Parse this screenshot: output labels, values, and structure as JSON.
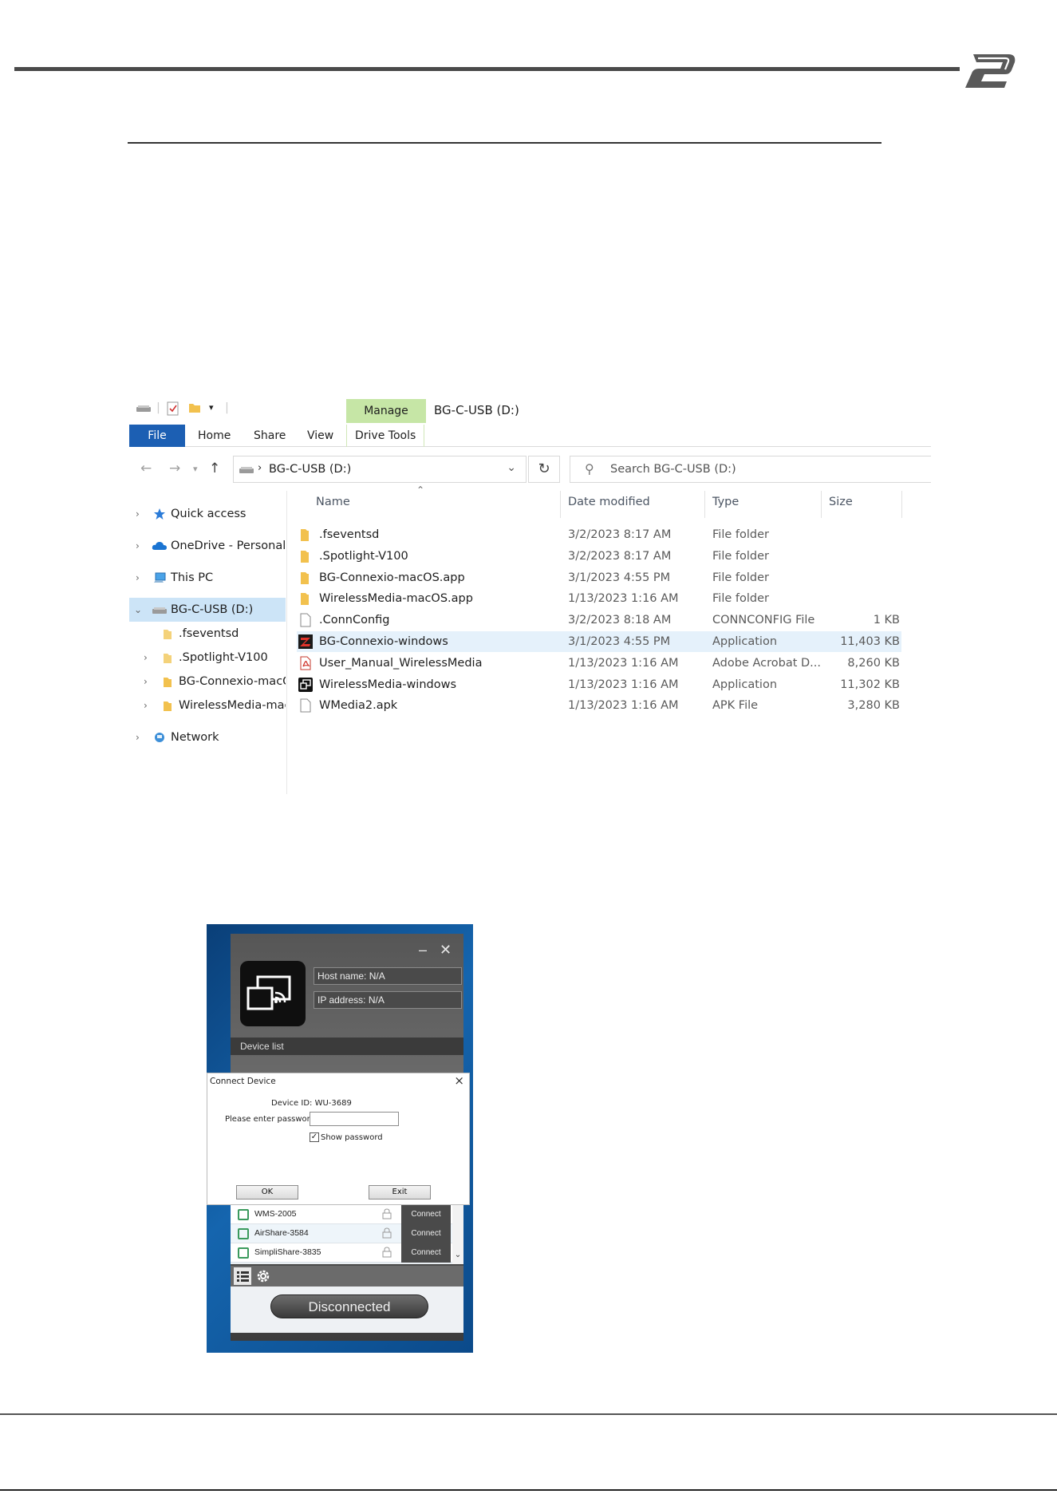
{
  "explorer": {
    "ribbon": {
      "manage": "Manage",
      "title": "BG-C-USB (D:)",
      "tabs": [
        "File",
        "Home",
        "Share",
        "View",
        "Drive Tools"
      ]
    },
    "address": {
      "path": "BG-C-USB (D:)",
      "search_placeholder": "Search BG-C-USB (D:)"
    },
    "nav": [
      {
        "label": "Quick access"
      },
      {
        "label": "OneDrive - Personal"
      },
      {
        "label": "This PC"
      },
      {
        "label": "BG-C-USB (D:)"
      },
      {
        "label": ".fseventsd"
      },
      {
        "label": ".Spotlight-V100"
      },
      {
        "label": "BG-Connexio-macO"
      },
      {
        "label": "WirelessMedia-mac"
      },
      {
        "label": "Network"
      }
    ],
    "columns": [
      "Name",
      "Date modified",
      "Type",
      "Size"
    ],
    "files": [
      {
        "name": ".fseventsd",
        "date": "3/2/2023 8:17 AM",
        "type": "File folder",
        "size": "",
        "icon": "folder-icon"
      },
      {
        "name": ".Spotlight-V100",
        "date": "3/2/2023 8:17 AM",
        "type": "File folder",
        "size": "",
        "icon": "folder-icon"
      },
      {
        "name": "BG-Connexio-macOS.app",
        "date": "3/1/2023 4:55 PM",
        "type": "File folder",
        "size": "",
        "icon": "folder-icon"
      },
      {
        "name": "WirelessMedia-macOS.app",
        "date": "1/13/2023 1:16 AM",
        "type": "File folder",
        "size": "",
        "icon": "folder-icon"
      },
      {
        "name": ".ConnConfig",
        "date": "3/2/2023 8:18 AM",
        "type": "CONNCONFIG File",
        "size": "1 KB",
        "icon": "file-icon"
      },
      {
        "name": "BG-Connexio-windows",
        "date": "3/1/2023 4:55 PM",
        "type": "Application",
        "size": "11,403 KB",
        "icon": "bg-app-icon"
      },
      {
        "name": "User_Manual_WirelessMedia",
        "date": "1/13/2023 1:16 AM",
        "type": "Adobe Acrobat D...",
        "size": "8,260 KB",
        "icon": "pdf-icon"
      },
      {
        "name": "WirelessMedia-windows",
        "date": "1/13/2023 1:16 AM",
        "type": "Application",
        "size": "11,302 KB",
        "icon": "wm-app-icon"
      },
      {
        "name": "WMedia2.apk",
        "date": "1/13/2023 1:16 AM",
        "type": "APK File",
        "size": "3,280 KB",
        "icon": "file-icon"
      }
    ]
  },
  "app": {
    "host_name": "Host name:  N/A",
    "ip_address": "IP address:  N/A",
    "device_list": "Device list",
    "dialog": {
      "title": "Connect Device",
      "device_id": "Device ID:  WU-3689",
      "password_label": "Please enter password:",
      "show_password": "Show password",
      "ok": "OK",
      "exit": "Exit"
    },
    "devices": [
      {
        "name": "WMS-2005",
        "action": "Connect"
      },
      {
        "name": "AirShare-3584",
        "action": "Connect"
      },
      {
        "name": "SimpliShare-3835",
        "action": "Connect"
      }
    ],
    "status": "Disconnected"
  },
  "colors": {
    "accent": "#1c5fb3",
    "manage_tab": "#c6e6a6",
    "selection": "#cce4f7"
  }
}
